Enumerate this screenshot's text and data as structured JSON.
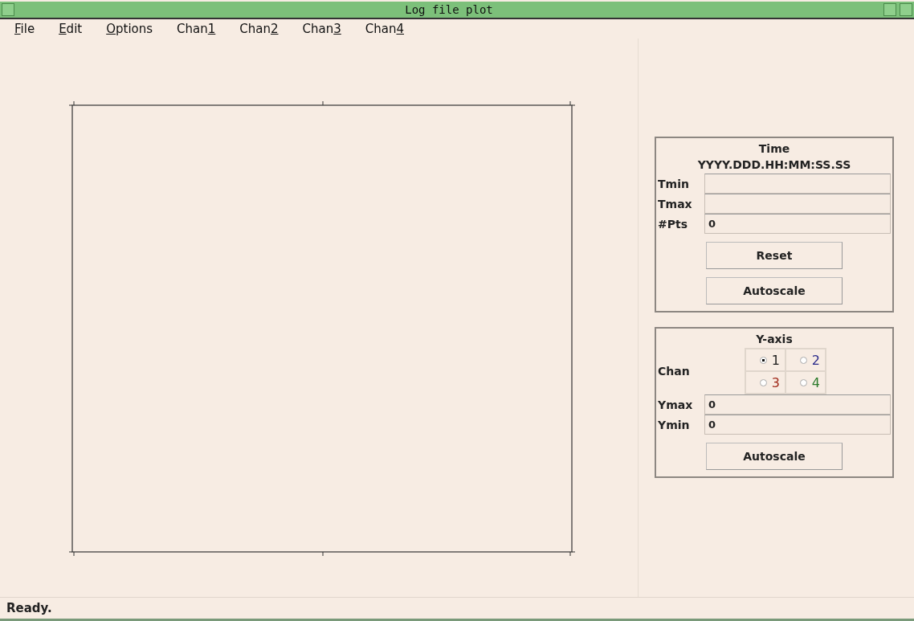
{
  "window": {
    "title": "Log file plot"
  },
  "menu": [
    {
      "key": "F",
      "suffix": "ile"
    },
    {
      "key": "E",
      "suffix": "dit"
    },
    {
      "key": "O",
      "suffix": "ptions"
    },
    {
      "prefix": "Chan",
      "key": "1"
    },
    {
      "prefix": "Chan",
      "key": "2"
    },
    {
      "prefix": "Chan",
      "key": "3"
    },
    {
      "prefix": "Chan",
      "key": "4"
    }
  ],
  "time_panel": {
    "title": "Time",
    "format": "YYYY.DDD.HH:MM:SS.SS",
    "fields": [
      {
        "label": "Tmin"
      },
      {
        "label": "Tmax"
      },
      {
        "label": "#Pts",
        "value": "0"
      }
    ],
    "buttons": [
      "Reset",
      "Autoscale"
    ]
  },
  "yaxis_panel": {
    "title": "Y-axis",
    "chan_label": "Chan",
    "channels": [
      {
        "label": "1",
        "selected": true,
        "color": "#1a1a1a"
      },
      {
        "label": "2",
        "selected": false,
        "color": "#2a2a8a"
      },
      {
        "label": "3",
        "selected": false,
        "color": "#a02a1a"
      },
      {
        "label": "4",
        "selected": false,
        "color": "#2a7a2a"
      }
    ],
    "fields": [
      {
        "label": "Ymax",
        "value": "0"
      },
      {
        "label": "Ymin",
        "value": "0"
      }
    ],
    "buttons": [
      "Autoscale"
    ]
  },
  "status_bar": {
    "text": "Ready."
  }
}
